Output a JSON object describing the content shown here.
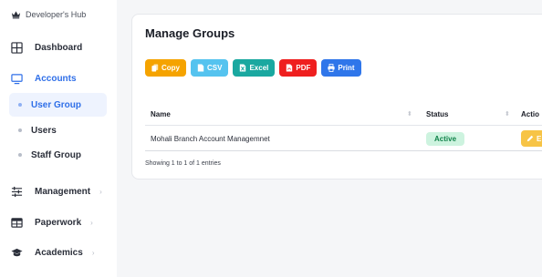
{
  "sidebar": {
    "brand": "Developer's Hub",
    "items": [
      {
        "label": "Dashboard",
        "icon": "grid-icon"
      },
      {
        "label": "Accounts",
        "icon": "monitor-icon"
      },
      {
        "label": "Management",
        "icon": "sliders-icon"
      },
      {
        "label": "Paperwork",
        "icon": "table-icon"
      },
      {
        "label": "Academics",
        "icon": "graduation-cap-icon"
      }
    ],
    "sub_items": [
      {
        "label": "User Group"
      },
      {
        "label": "Users"
      },
      {
        "label": "Staff Group"
      }
    ],
    "chevron": "›"
  },
  "main": {
    "title": "Manage Groups",
    "buttons": {
      "copy": "Copy",
      "csv": "CSV",
      "excel": "Excel",
      "pdf": "PDF",
      "print": "Print"
    },
    "table": {
      "headers": {
        "name": "Name",
        "status": "Status",
        "action": "Actio"
      },
      "rows": [
        {
          "name": "Mohali Branch Account Managemnet",
          "status": "Active",
          "action": "E"
        }
      ]
    },
    "info": "Showing 1 to 1 of 1 entries"
  },
  "colors": {
    "accent": "#2f6fe8",
    "copy": "#f5a300",
    "csv": "#55c3ef",
    "excel": "#1aa8a0",
    "pdf": "#ef1f1f",
    "print": "#2f76ea",
    "active_badge_bg": "#cdf3df",
    "active_badge_text": "#11834a",
    "edit": "#f7c446"
  }
}
